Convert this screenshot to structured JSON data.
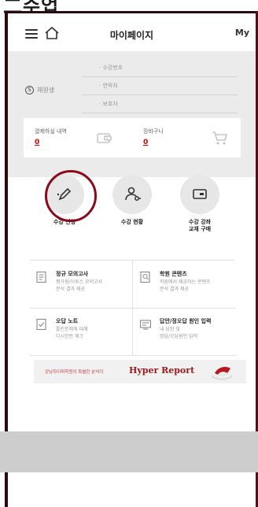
{
  "colors": {
    "accent_red": "#c00000",
    "frame": "#2a0a0e",
    "gray_section": "#ebebeb",
    "circle_bg": "#e7e7e7"
  },
  "frame": {
    "title": "二수업"
  },
  "header": {
    "title": "마이페이지",
    "my_label": "My",
    "icons": [
      "menu-icon",
      "home-icon"
    ]
  },
  "user": {
    "name": "재원생",
    "badge": "S",
    "fields": [
      "· 수강번호",
      "· 연락처",
      "· 보호자"
    ]
  },
  "summary": [
    {
      "label": "결제하실 내역",
      "count": "0",
      "icon": "wallet-icon"
    },
    {
      "label": "장바구니",
      "count": "0",
      "icon": "cart-icon"
    }
  ],
  "quick_menu": [
    {
      "label": "수강 신청",
      "icon": "pencil-icon",
      "highlighted": true
    },
    {
      "label": "수강 현황",
      "icon": "person-key-icon",
      "highlighted": false
    },
    {
      "label": "수강 강좌\n교재 구매",
      "icon": "card-icon",
      "highlighted": false
    }
  ],
  "menu_grid": [
    {
      "title": "정규 모의고사",
      "desc": "평가원/이투스 모의고사\n분석 결과 제공",
      "icon": "document-icon"
    },
    {
      "title": "학원 콘텐츠",
      "desc": "학원에서 제공하는 콘텐츠\n분석 결과 제공",
      "icon": "search-doc-icon"
    },
    {
      "title": "오답 노트",
      "desc": "틀린문제에 대해\n다시한번 체크",
      "icon": "check-doc-icon"
    },
    {
      "title": "답안/정오답 원인 입력",
      "desc": "내 답안 및\n정답/오답원인 입력",
      "icon": "input-icon"
    }
  ],
  "banner": {
    "small_text": "강남하이퍼학원의 특별한 분석지",
    "brand": "Hyper Report"
  }
}
